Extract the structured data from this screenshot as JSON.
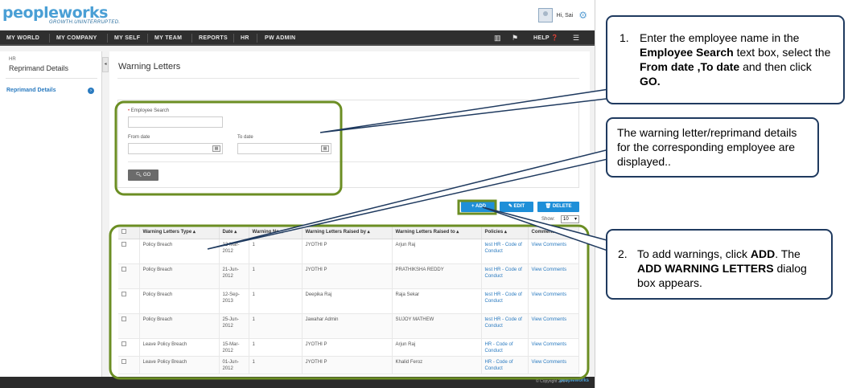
{
  "app": {
    "logo_text": "peopleworks",
    "logo_tagline": "GROWTH.UNINTERRUPTED.",
    "greeting": "Hi, Sai",
    "nav": [
      "MY WORLD",
      "MY COMPANY",
      "MY SELF",
      "MY TEAM",
      "REPORTS",
      "HR",
      "PW ADMIN"
    ],
    "help_label": "HELP"
  },
  "sidebar": {
    "section_small": "HR",
    "section_title": "Reprimand Details",
    "active_item": "Reprimand Details"
  },
  "main": {
    "title": "Warning Letters",
    "search": {
      "employee_label": "Employee Search",
      "from_label": "From date",
      "to_label": "To date",
      "go_label": "GO"
    },
    "actions": {
      "add": "ADD",
      "edit": "EDIT",
      "delete": "DELETE"
    },
    "show_label": "Show:",
    "show_value": "10",
    "table": {
      "headers": [
        "Warning Letters Type",
        "Date",
        "Warning No",
        "Warning Letters Raised by",
        "Warning Letters Raised to",
        "Policies",
        "Comments"
      ],
      "rows": [
        {
          "type": "Policy Breach",
          "date": "12-Mar-2012",
          "no": "1",
          "by": "JYOTHI P",
          "to": "Arjun Raj",
          "policy": "test HR - Code of Conduct",
          "comments": "View Comments"
        },
        {
          "type": "Policy Breach",
          "date": "21-Jun-2012",
          "no": "1",
          "by": "JYOTHI P",
          "to": "PRATHIKSHA REDDY",
          "policy": "test HR - Code of Conduct",
          "comments": "View Comments"
        },
        {
          "type": "Policy Breach",
          "date": "12-Sep-2013",
          "no": "1",
          "by": "Deepika Raj",
          "to": "Raja Sekar",
          "policy": "test HR - Code of Conduct",
          "comments": "View Comments"
        },
        {
          "type": "Policy Breach",
          "date": "25-Jun-2012",
          "no": "1",
          "by": "Jawahar Admin",
          "to": "SUJOY MATHEW",
          "policy": "test HR - Code of Conduct",
          "comments": "View Comments"
        },
        {
          "type": "Leave Policy Breach",
          "date": "15-Mar-2012",
          "no": "1",
          "by": "JYOTHI P",
          "to": "Arjun Raj",
          "policy": "HR - Code of Conduct",
          "comments": "View Comments"
        },
        {
          "type": "Leave Policy Breach",
          "date": "01-Jun-2012",
          "no": "1",
          "by": "JYOTHI P",
          "to": "Khalid Feroz",
          "policy": "HR - Code of Conduct",
          "comments": "View Comments"
        }
      ]
    }
  },
  "footer": {
    "copyright": "© Copyright 2014",
    "logo": "peopleworks"
  },
  "callouts": {
    "c1": {
      "num": "1.",
      "t1": "Enter the employee name in the ",
      "b1": "Employee Search",
      "t2": " text box, select the ",
      "b2": "From date ,To date",
      "t3": " and then click ",
      "b3": "GO."
    },
    "c2": {
      "text": "The warning letter/reprimand details for the corresponding employee are displayed.."
    },
    "c3": {
      "num": "2.",
      "t1": "To add  warnings, click ",
      "b1": "ADD",
      "t2": ". The ",
      "b2": "ADD WARNING LETTERS",
      "t3": " dialog box appears."
    }
  },
  "colors": {
    "accent": "#1f8fd8",
    "highlight": "#6b8e23",
    "callout_border": "#1f3a5f",
    "navbar": "#2f2f2f"
  }
}
